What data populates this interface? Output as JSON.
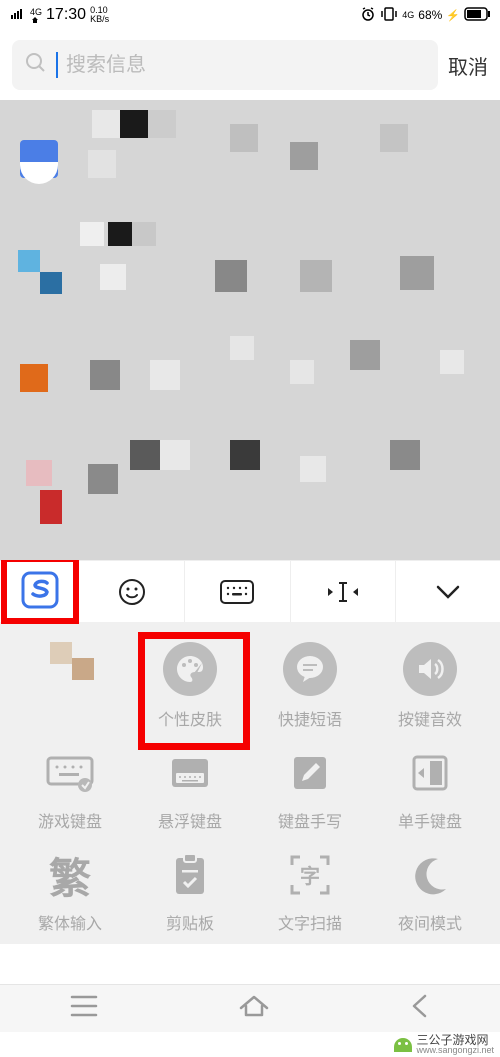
{
  "status": {
    "network": "4G",
    "time": "17:30",
    "speed_top": "0.10",
    "speed_unit": "KB/s",
    "battery": "68%"
  },
  "search": {
    "placeholder": "搜索信息",
    "cancel": "取消"
  },
  "keyboard": {
    "logo": "S",
    "settings": [
      {
        "label": "",
        "icon": "pixelated"
      },
      {
        "label": "个性皮肤",
        "icon": "palette",
        "highlighted": true
      },
      {
        "label": "快捷短语",
        "icon": "message"
      },
      {
        "label": "按键音效",
        "icon": "volume"
      },
      {
        "label": "游戏键盘",
        "icon": "gamepad"
      },
      {
        "label": "悬浮键盘",
        "icon": "float-kb"
      },
      {
        "label": "键盘手写",
        "icon": "handwrite"
      },
      {
        "label": "单手键盘",
        "icon": "onehand"
      },
      {
        "label": "繁体输入",
        "icon": "traditional"
      },
      {
        "label": "剪贴板",
        "icon": "clipboard"
      },
      {
        "label": "文字扫描",
        "icon": "scan"
      },
      {
        "label": "夜间模式",
        "icon": "moon"
      }
    ],
    "traditional_glyph": "繁"
  },
  "watermark": {
    "text": "三公子游戏网",
    "url": "www.sangongzi.net"
  }
}
